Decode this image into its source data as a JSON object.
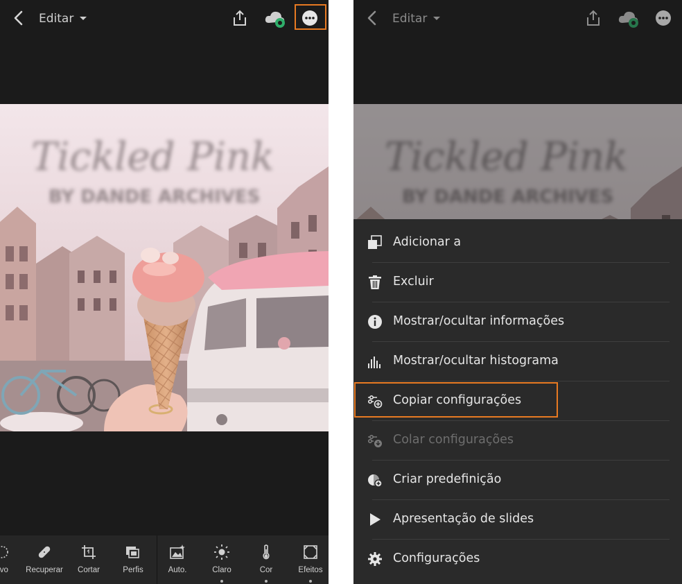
{
  "header": {
    "title": "Editar"
  },
  "toolbar": {
    "tools": [
      {
        "label": "tivo",
        "icon": "selective-icon"
      },
      {
        "label": "Recuperar",
        "icon": "healing-bandage-icon"
      },
      {
        "label": "Cortar",
        "icon": "crop-icon"
      },
      {
        "label": "Perfis",
        "icon": "profiles-icon"
      },
      {
        "label": "Auto.",
        "icon": "auto-enhance-icon"
      },
      {
        "label": "Claro",
        "icon": "sun-icon"
      },
      {
        "label": "Cor",
        "icon": "thermometer-icon"
      },
      {
        "label": "Efeitos",
        "icon": "effects-icon"
      }
    ]
  },
  "menu": {
    "items": [
      {
        "label": "Adicionar a",
        "icon": "add-to-album-icon",
        "enabled": true
      },
      {
        "label": "Excluir",
        "icon": "trash-icon",
        "enabled": true
      },
      {
        "label": "Mostrar/ocultar informações",
        "icon": "info-icon",
        "enabled": true
      },
      {
        "label": "Mostrar/ocultar histograma",
        "icon": "histogram-icon",
        "enabled": true
      },
      {
        "label": "Copiar configurações",
        "icon": "copy-settings-icon",
        "enabled": true,
        "highlighted": true
      },
      {
        "label": "Colar configurações",
        "icon": "paste-settings-icon",
        "enabled": false
      },
      {
        "label": "Criar predefinição",
        "icon": "create-preset-icon",
        "enabled": true
      },
      {
        "label": "Apresentação de slides",
        "icon": "play-icon",
        "enabled": true
      },
      {
        "label": "Configurações",
        "icon": "gear-icon",
        "enabled": true
      }
    ]
  },
  "colors": {
    "highlight": "#e87a22",
    "background": "#1b1b1b",
    "menu_background": "#2a2a2a",
    "cloud_badge": "#2fae6a"
  }
}
